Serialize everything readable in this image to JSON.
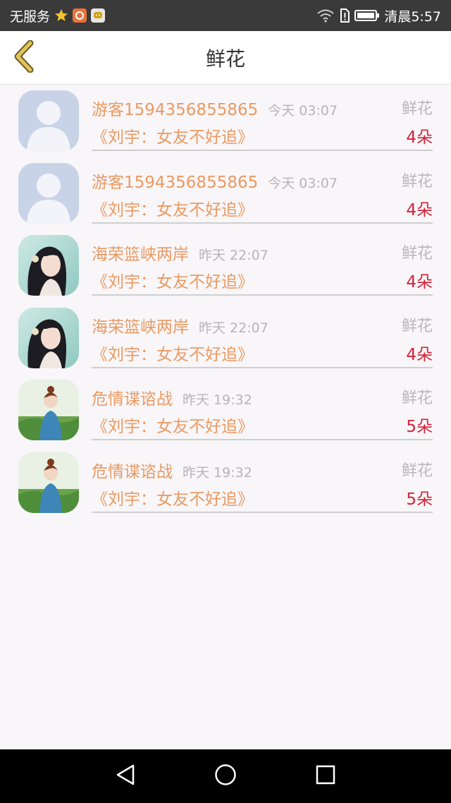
{
  "status_bar": {
    "carrier": "无服务",
    "clock": "清晨5:57"
  },
  "header": {
    "title": "鲜花"
  },
  "records": [
    {
      "name": "游客1594356855865",
      "time": "今天 03:07",
      "gift": "鲜花",
      "book": "《刘宇：女友不好追》",
      "count": "4朵",
      "avatar": "default-avatar"
    },
    {
      "name": "游客1594356855865",
      "time": "今天 03:07",
      "gift": "鲜花",
      "book": "《刘宇：女友不好追》",
      "count": "4朵",
      "avatar": "default-avatar"
    },
    {
      "name": "海荣篮峡两岸",
      "time": "昨天 22:07",
      "gift": "鲜花",
      "book": "《刘宇：女友不好追》",
      "count": "4朵",
      "avatar": "girl-painting-avatar"
    },
    {
      "name": "海荣篮峡两岸",
      "time": "昨天 22:07",
      "gift": "鲜花",
      "book": "《刘宇：女友不好追》",
      "count": "4朵",
      "avatar": "girl-painting-avatar"
    },
    {
      "name": "危情谍谘战",
      "time": "昨天 19:32",
      "gift": "鲜花",
      "book": "《刘宇：女友不好追》",
      "count": "5朵",
      "avatar": "girl-photo-avatar"
    },
    {
      "name": "危情谍谘战",
      "time": "昨天 19:32",
      "gift": "鲜花",
      "book": "《刘宇：女友不好追》",
      "count": "5朵",
      "avatar": "girl-photo-avatar"
    }
  ],
  "colors": {
    "accent": "#ea9a63",
    "count": "#d2233a",
    "back_arrow": "#c8a84a"
  }
}
